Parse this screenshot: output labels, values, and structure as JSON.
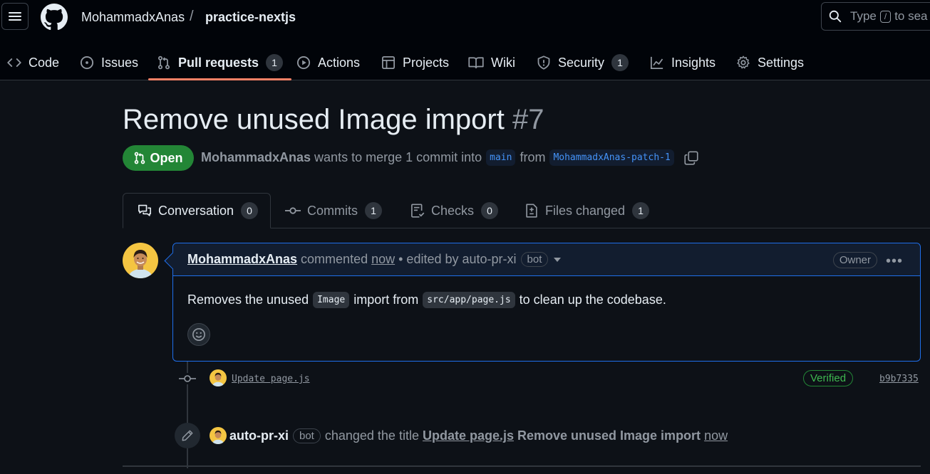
{
  "header": {
    "owner": "MohammadxAnas",
    "separator": "/",
    "repo": "practice-nextjs",
    "search_prefix": "Type",
    "search_key": "/",
    "search_suffix": "to sea"
  },
  "repo_tabs": [
    {
      "label": "Code",
      "icon": "code-icon"
    },
    {
      "label": "Issues",
      "icon": "issue-opened-icon"
    },
    {
      "label": "Pull requests",
      "icon": "git-pull-request-icon",
      "count": "1",
      "selected": true
    },
    {
      "label": "Actions",
      "icon": "play-icon"
    },
    {
      "label": "Projects",
      "icon": "table-icon"
    },
    {
      "label": "Wiki",
      "icon": "book-icon"
    },
    {
      "label": "Security",
      "icon": "shield-icon",
      "count": "1"
    },
    {
      "label": "Insights",
      "icon": "graph-icon"
    },
    {
      "label": "Settings",
      "icon": "gear-icon"
    }
  ],
  "pr": {
    "title": "Remove unused Image import",
    "number": "#7",
    "state": "Open",
    "author": "MohammadxAnas",
    "merge_text": "wants to merge 1 commit into",
    "base_branch": "main",
    "from_text": "from",
    "head_branch": "MohammadxAnas-patch-1"
  },
  "pr_tabs": [
    {
      "label": "Conversation",
      "count": "0",
      "icon": "comment-discussion-icon"
    },
    {
      "label": "Commits",
      "count": "1",
      "icon": "git-commit-icon"
    },
    {
      "label": "Checks",
      "count": "0",
      "icon": "checklist-icon"
    },
    {
      "label": "Files changed",
      "count": "1",
      "icon": "file-diff-icon"
    }
  ],
  "comment": {
    "author": "MohammadxAnas",
    "action": "commented",
    "time": "now",
    "edited_by": "• edited by auto-pr-xi",
    "bot_label": "bot",
    "role": "Owner",
    "body_text_1": "Removes the unused",
    "body_code_1": "Image",
    "body_text_2": "import from",
    "body_code_2": "src/app/page.js",
    "body_text_3": "to clean up the codebase."
  },
  "commit_event": {
    "message": "Update page.js",
    "status": "Verified",
    "sha": "b9b7335"
  },
  "rename_event": {
    "actor": "auto-pr-xi",
    "bot_label": "bot",
    "action": "changed the title",
    "old_title": "Update page.js",
    "new_title": "Remove unused Image import",
    "time": "now"
  },
  "colors": {
    "background": "#0d1117",
    "header_bg": "#010409",
    "open_green": "#238636",
    "accent_blue": "#1f6feb",
    "tab_underline": "#f78166"
  }
}
